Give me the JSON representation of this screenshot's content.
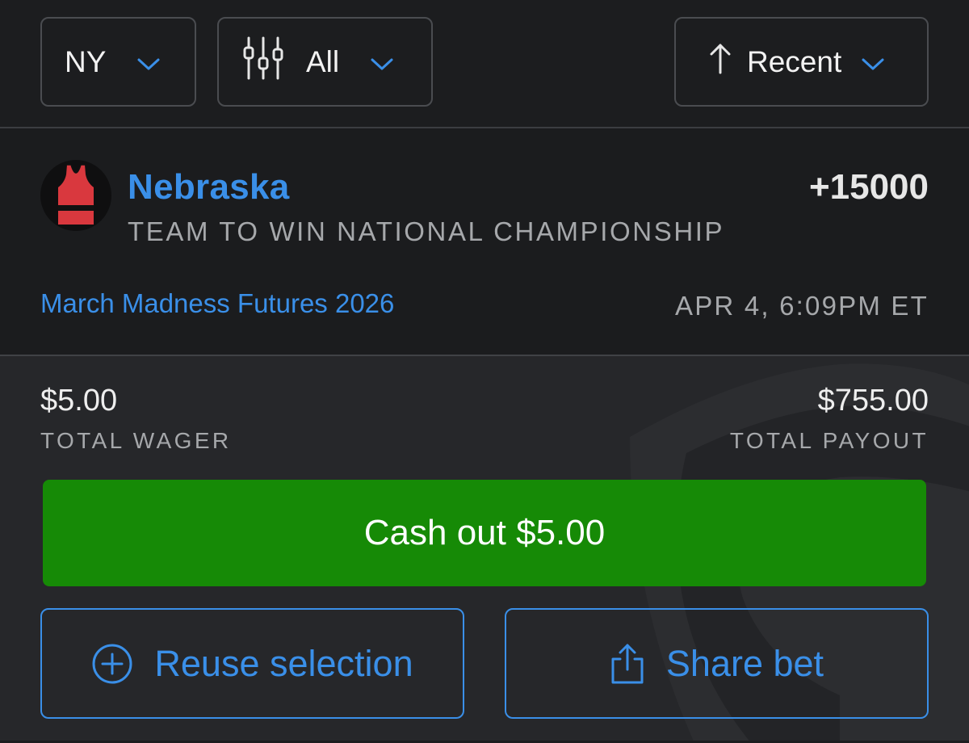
{
  "filters": {
    "state": "NY",
    "filter": "All",
    "sort": "Recent"
  },
  "bet": {
    "team": "Nebraska",
    "odds": "+15000",
    "market": "TEAM TO WIN NATIONAL CHAMPIONSHIP",
    "event": "March Madness Futures 2026",
    "placed_at": "APR 4, 6:09PM ET",
    "jersey_colors": {
      "body": "#d9383e",
      "stripe": "#111111"
    }
  },
  "wager": {
    "value": "$5.00",
    "label": "TOTAL WAGER"
  },
  "payout": {
    "value": "$755.00",
    "label": "TOTAL PAYOUT"
  },
  "actions": {
    "cashout": "Cash out $5.00",
    "reuse": "Reuse selection",
    "share": "Share bet"
  },
  "colors": {
    "accent_blue": "#3a8fe8",
    "cashout_green": "#168a06"
  },
  "icons": {
    "chevron": "chevron-down-icon",
    "sliders": "sliders-icon",
    "sort": "arrow-up-icon",
    "reuse": "plus-circle-icon",
    "share": "share-icon",
    "jersey": "jersey-icon"
  }
}
